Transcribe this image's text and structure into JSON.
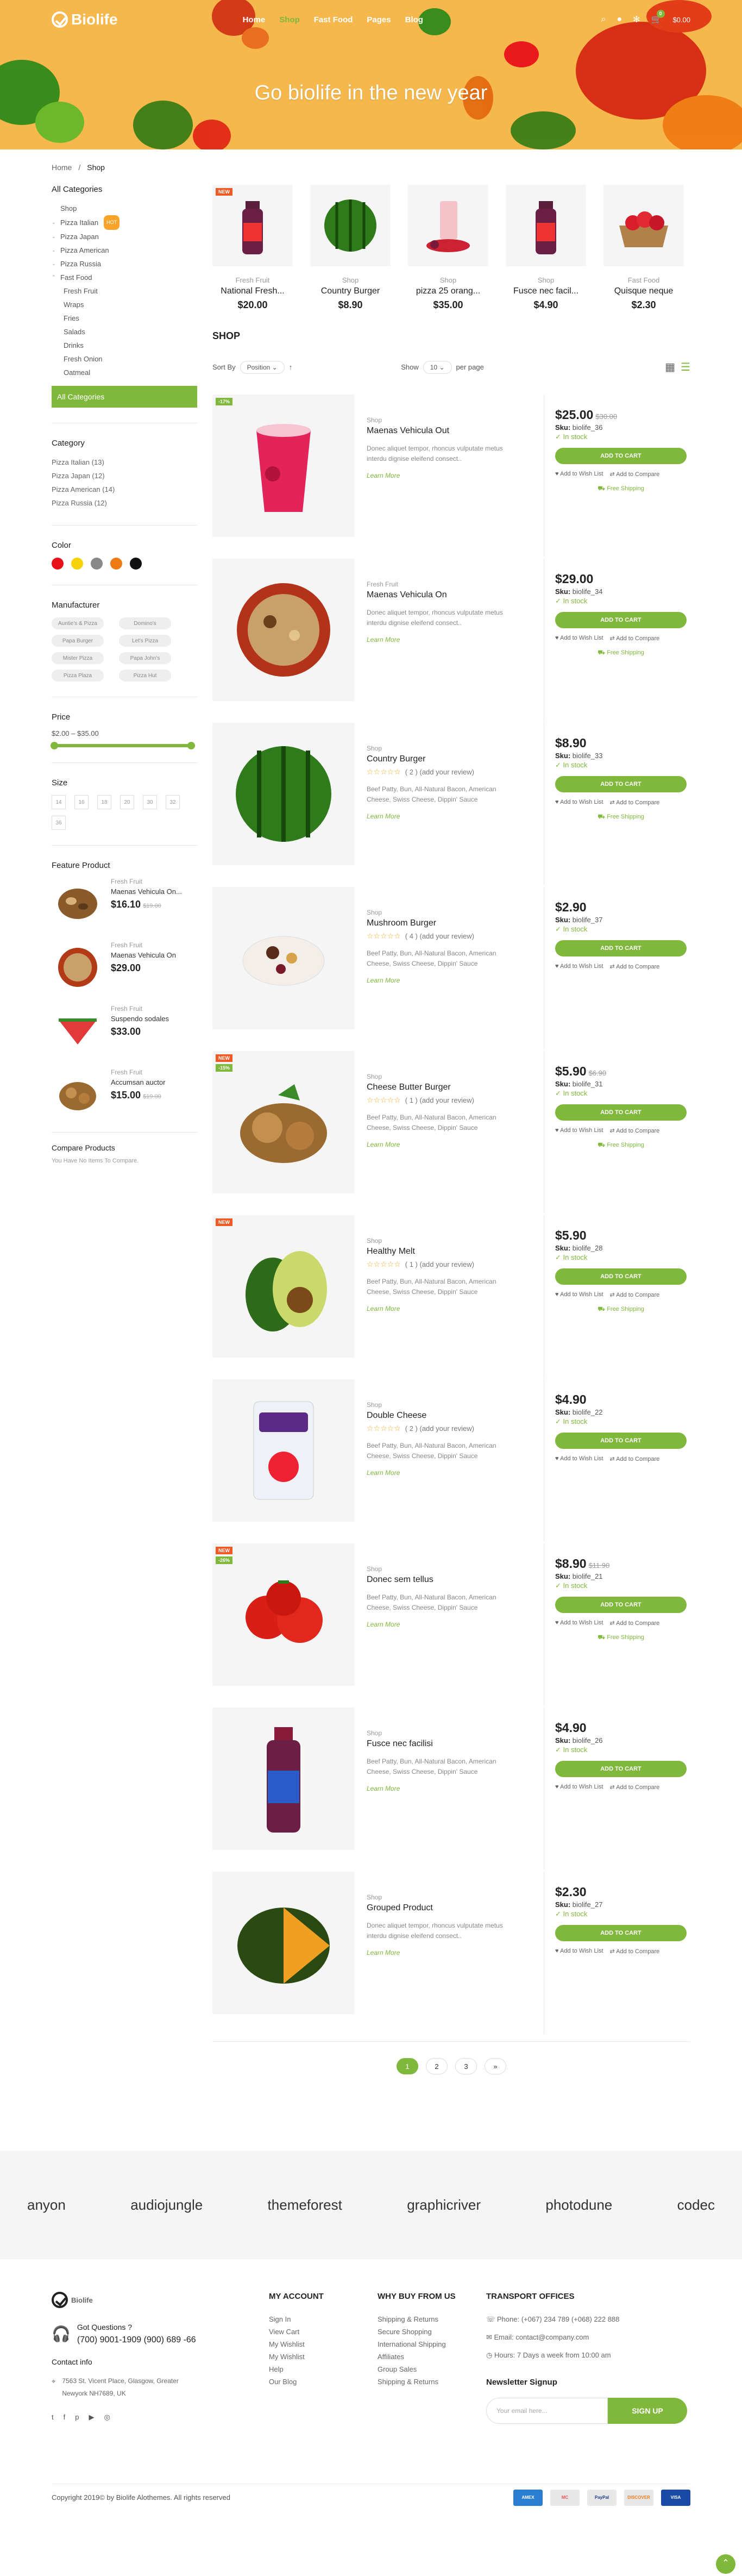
{
  "brand": {
    "name": "Biolife"
  },
  "nav": [
    "Home",
    "Shop",
    "Fast Food",
    "Pages",
    "Blog"
  ],
  "header": {
    "cart_count": "0",
    "cart_total": "$0.00"
  },
  "hero": {
    "title": "Go biolife in the new year"
  },
  "breadcrumb": {
    "home": "Home",
    "current": "Shop"
  },
  "sidebar": {
    "all_categories_title": "All Categories",
    "categories": [
      "Shop",
      "Pizza Italian",
      "Pizza Japan",
      "Pizza American",
      "Pizza Russia",
      "Fast Food"
    ],
    "hot_label": "HOT",
    "fastfood_sub": [
      "Fresh Fruit",
      "Wraps",
      "Fries",
      "Salads",
      "Drinks",
      "Fresh Onion",
      "Oatmeal"
    ],
    "all_categories_button": "All Categories",
    "category_title": "Category",
    "category_counts": [
      "Pizza Italian (13)",
      "Pizza Japan (12)",
      "Pizza American (14)",
      "Pizza Russia (12)"
    ],
    "color_title": "Color",
    "colors": [
      "#e8101a",
      "#f5d20a",
      "#888888",
      "#ef7c12",
      "#111111"
    ],
    "manufacturer_title": "Manufacturer",
    "manufacturers": [
      "Auntie's & Pizza",
      "Domino's",
      "Papa Burger",
      "Let's Pizza",
      "Mister Pizza",
      "Papa John's",
      "Pizza Plaza",
      "Pizza Hut"
    ],
    "price_title": "Price",
    "price_range": "$2.00 – $35.00",
    "size_title": "Size",
    "sizes": [
      "14",
      "16",
      "18",
      "20",
      "30",
      "32",
      "36"
    ],
    "feature_title": "Feature Product",
    "features": [
      {
        "cat": "Fresh Fruit",
        "name": "Maenas Vehicula On...",
        "price": "$16.10",
        "old": "$19.00"
      },
      {
        "cat": "Fresh Fruit",
        "name": "Maenas Vehicula On",
        "price": "$29.00",
        "old": ""
      },
      {
        "cat": "Fresh Fruit",
        "name": "Suspendo sodales",
        "price": "$33.00",
        "old": ""
      },
      {
        "cat": "Fresh Fruit",
        "name": "Accumsan auctor",
        "price": "$15.00",
        "old": "$19.00"
      }
    ],
    "compare_title": "Compare Products",
    "compare_text": "You Have No Items To Compare."
  },
  "top_products": [
    {
      "cat": "Fresh Fruit",
      "name": "National Fresh...",
      "price": "$20.00",
      "badge": "NEW"
    },
    {
      "cat": "Shop",
      "name": "Country Burger",
      "price": "$8.90",
      "badge": ""
    },
    {
      "cat": "Shop",
      "name": "pizza 25 orang...",
      "price": "$35.00",
      "badge": ""
    },
    {
      "cat": "Shop",
      "name": "Fusce nec facil...",
      "price": "$4.90",
      "badge": ""
    },
    {
      "cat": "Fast Food",
      "name": "Quisque neque",
      "price": "$2.30",
      "badge": ""
    }
  ],
  "shop": {
    "title": "SHOP",
    "sort_label": "Sort By",
    "sort_value": "Position",
    "show_label": "Show",
    "show_value": "10",
    "per_page": "per page",
    "read_more": "Learn More",
    "add_to_cart": "ADD TO CART",
    "wishlist": "Add to Wish List",
    "compare": "Add to Compare",
    "free_ship": "Free Shipping",
    "in_stock": "In stock",
    "sku_label": "Sku:"
  },
  "products": [
    {
      "cat": "Shop",
      "name": "Maenas Vehicula Out",
      "price": "$25.00",
      "old": "$30.00",
      "sku": "biolife_36",
      "stars": "",
      "review": "",
      "desc": "Donec aliquet tempor, rhoncus vulputate metus interdu dignise eleifend consect..",
      "badge": "-17%",
      "badge2": "",
      "ship": true
    },
    {
      "cat": "Fresh Fruit",
      "name": "Maenas Vehicula On",
      "price": "$29.00",
      "old": "",
      "sku": "biolife_34",
      "stars": "",
      "review": "",
      "desc": "Donec aliquet tempor, rhoncus vulputate metus interdu dignise eleifend consect..",
      "badge": "",
      "badge2": "",
      "ship": true
    },
    {
      "cat": "Shop",
      "name": "Country Burger",
      "price": "$8.90",
      "old": "",
      "sku": "biolife_33",
      "stars": "☆☆☆☆☆",
      "review": "( 2 )  (add your review)",
      "desc": "Beef Patty, Bun, All-Natural Bacon, American Cheese, Swiss Cheese, Dippin' Sauce",
      "badge": "",
      "badge2": "",
      "ship": true
    },
    {
      "cat": "Shop",
      "name": "Mushroom Burger",
      "price": "$2.90",
      "old": "",
      "sku": "biolife_37",
      "stars": "☆☆☆☆☆",
      "review": "( 4 )  (add your review)",
      "desc": "Beef Patty, Bun, All-Natural Bacon, American Cheese, Swiss Cheese, Dippin' Sauce",
      "badge": "",
      "badge2": "",
      "ship": false
    },
    {
      "cat": "Shop",
      "name": "Cheese Butter Burger",
      "price": "$5.90",
      "old": "$6.90",
      "sku": "biolife_31",
      "stars": "☆☆☆☆☆",
      "review": "( 1 )  (add your review)",
      "desc": "Beef Patty, Bun, All-Natural Bacon, American Cheese, Swiss Cheese, Dippin' Sauce",
      "badge": "NEW",
      "badge2": "-15%",
      "ship": true
    },
    {
      "cat": "Shop",
      "name": "Healthy Melt",
      "price": "$5.90",
      "old": "",
      "sku": "biolife_28",
      "stars": "☆☆☆☆☆",
      "review": "( 1 )  (add your review)",
      "desc": "Beef Patty, Bun, All-Natural Bacon, American Cheese, Swiss Cheese, Dippin' Sauce",
      "badge": "NEW",
      "badge2": "",
      "ship": true
    },
    {
      "cat": "Shop",
      "name": "Double Cheese",
      "price": "$4.90",
      "old": "",
      "sku": "biolife_22",
      "stars": "☆☆☆☆☆",
      "review": "( 2 )  (add your review)",
      "desc": "Beef Patty, Bun, All-Natural Bacon, American Cheese, Swiss Cheese, Dippin' Sauce",
      "badge": "",
      "badge2": "",
      "ship": false
    },
    {
      "cat": "Shop",
      "name": "Donec sem tellus",
      "price": "$8.90",
      "old": "$11.90",
      "sku": "biolife_21",
      "stars": "",
      "review": "",
      "desc": "Beef Patty, Bun, All-Natural Bacon, American Cheese, Swiss Cheese, Dippin' Sauce",
      "badge": "NEW",
      "badge2": "-26%",
      "ship": true
    },
    {
      "cat": "Shop",
      "name": "Fusce nec facilisi",
      "price": "$4.90",
      "old": "",
      "sku": "biolife_26",
      "stars": "",
      "review": "",
      "desc": "Beef Patty, Bun, All-Natural Bacon, American Cheese, Swiss Cheese, Dippin' Sauce",
      "badge": "",
      "badge2": "",
      "ship": false
    },
    {
      "cat": "Shop",
      "name": "Grouped Product",
      "price": "$2.30",
      "old": "",
      "sku": "biolife_27",
      "stars": "",
      "review": "",
      "desc": "Donec aliquet tempor, rhoncus vulputate metus interdu dignise eleifend consect..",
      "badge": "",
      "badge2": "",
      "ship": false
    }
  ],
  "pagination": [
    "1",
    "2",
    "3",
    "»"
  ],
  "brands": [
    "anyon",
    "audiojungle",
    "themeforest",
    "graphicriver",
    "photodune",
    "codec"
  ],
  "footer": {
    "question": "Got Questions ?",
    "phone": "(700)  9001-1909  (900) 689 -66",
    "contact_title": "Contact info",
    "address": "7563 St. Vicent Place, Glasgow, Greater Newyork NH7689, UK",
    "account_title": "MY ACCOUNT",
    "account_links": [
      "Sign In",
      "View Cart",
      "My Wishlist",
      "My Wishlist",
      "Help",
      "Our Blog"
    ],
    "why_title": "WHY BUY FROM US",
    "why_links": [
      "Shipping & Returns",
      "Secure Shopping",
      "International Shipping",
      "Affiliates",
      "Group Sales",
      "Shipping & Returns"
    ],
    "transport_title": "TRANSPORT OFFICES",
    "t_phone": "Phone: (+067) 234 789 (+068) 222 888",
    "t_email": "Email: contact@company.com",
    "t_hours": "Hours: 7 Days a week from 10:00 am",
    "newsletter_title": "Newsletter Signup",
    "email_placeholder": "Your email here...",
    "signup": "SIGN UP",
    "copyright": "Copyright 2019© by Biolife Alothemes. All rights reserved",
    "payments": [
      "AMEX",
      "MC",
      "PayPal",
      "DISCOVER",
      "VISA"
    ]
  },
  "icons": [
    "search-icon",
    "user-icon",
    "gear-icon",
    "cart-icon",
    "heart-icon",
    "compare-icon",
    "truck-icon"
  ],
  "accent": "#7fb83b",
  "banner_color": "#f6b84d"
}
